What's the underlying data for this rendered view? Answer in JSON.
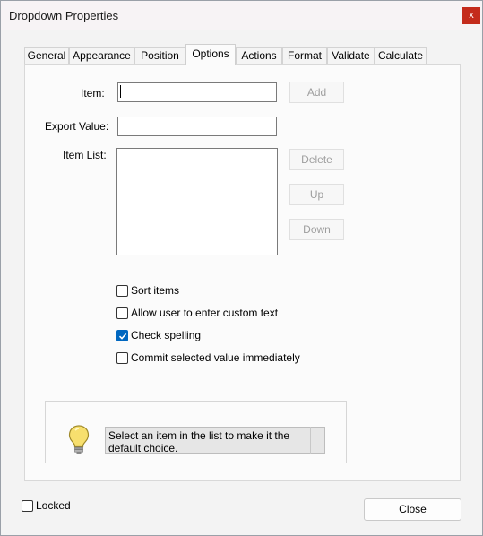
{
  "window": {
    "title": "Dropdown Properties",
    "close_glyph": "x"
  },
  "tabs": [
    {
      "label": "General"
    },
    {
      "label": "Appearance"
    },
    {
      "label": "Position"
    },
    {
      "label": "Options",
      "active": true
    },
    {
      "label": "Actions"
    },
    {
      "label": "Format"
    },
    {
      "label": "Validate"
    },
    {
      "label": "Calculate"
    }
  ],
  "options": {
    "item_label": "Item:",
    "item_value": "",
    "export_label": "Export Value:",
    "export_value": "",
    "item_list_label": "Item List:",
    "item_list": [],
    "buttons": {
      "add": "Add",
      "delete": "Delete",
      "up": "Up",
      "down": "Down"
    },
    "checkboxes": [
      {
        "label": "Sort items",
        "checked": false
      },
      {
        "label": "Allow user to enter custom text",
        "checked": false
      },
      {
        "label": "Check spelling",
        "checked": true
      },
      {
        "label": "Commit selected value immediately",
        "checked": false
      }
    ],
    "hint": "Select an item in the list to make it the default choice.",
    "hint_icon": "lightbulb-icon"
  },
  "footer": {
    "locked_label": "Locked",
    "locked_checked": false,
    "close_label": "Close"
  },
  "colors": {
    "accent": "#0067c0",
    "close_red": "#c42b1c"
  }
}
